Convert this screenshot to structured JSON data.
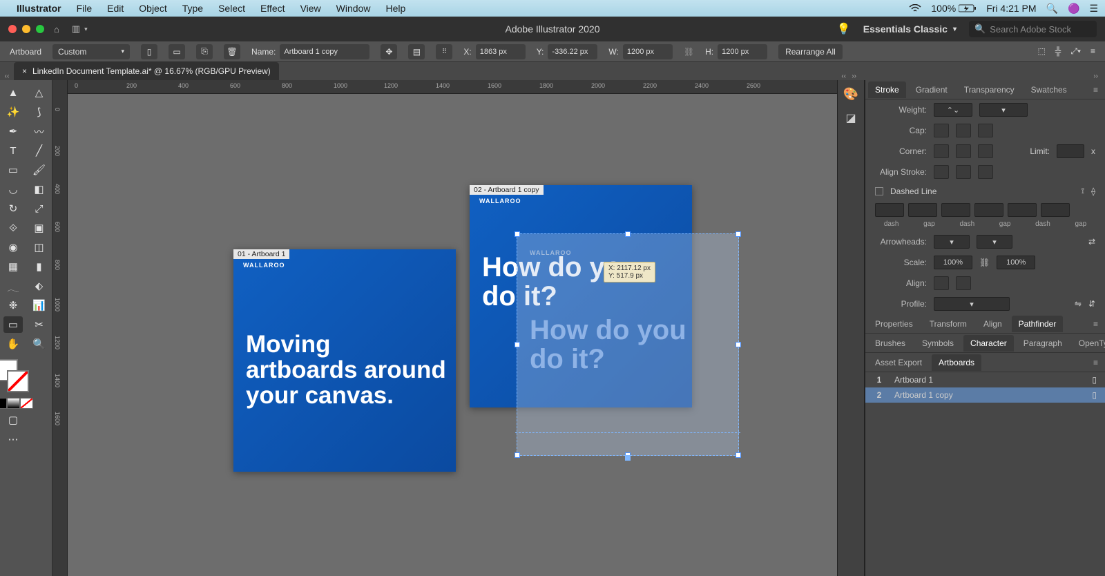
{
  "menubar": {
    "app": "Illustrator",
    "items": [
      "File",
      "Edit",
      "Object",
      "Type",
      "Select",
      "Effect",
      "View",
      "Window",
      "Help"
    ],
    "battery": "100%",
    "time": "Fri 4:21 PM"
  },
  "titlebar": {
    "title": "Adobe Illustrator 2020",
    "workspace": "Essentials Classic",
    "search_placeholder": "Search Adobe Stock"
  },
  "controlbar": {
    "tool": "Artboard",
    "preset": "Custom",
    "name_label": "Name:",
    "name_value": "Artboard 1 copy",
    "X_label": "X:",
    "X": "1863 px",
    "Y_label": "Y:",
    "Y": "-336.22 px",
    "W_label": "W:",
    "W": "1200 px",
    "H_label": "H:",
    "H": "1200 px",
    "rearrange": "Rearrange All"
  },
  "doc_tab": {
    "name": "LinkedIn Document Template.ai* @ 16.67% (RGB/GPU Preview)"
  },
  "ruler_ticks": [
    "0",
    "200",
    "400",
    "600",
    "800",
    "1000",
    "1200",
    "1400",
    "1600",
    "1800",
    "2000",
    "2200",
    "2400",
    "2600"
  ],
  "vruler_ticks": [
    "0",
    "200",
    "400",
    "600",
    "800",
    "1000",
    "1200",
    "1400",
    "1600"
  ],
  "artboards": {
    "a1": {
      "label": "01 - Artboard 1",
      "brand": "WALLAROO",
      "text": "Moving artboards around your canvas."
    },
    "a2": {
      "label": "02 - Artboard 1 copy",
      "brand": "WALLAROO",
      "text": "How do you do it?"
    }
  },
  "ghost": {
    "brand": "WALLAROO",
    "text": "How do you do it?",
    "tooltip_x": "X: 2117.12 px",
    "tooltip_y": "Y: 517.9 px"
  },
  "panels": {
    "row1": [
      "Stroke",
      "Gradient",
      "Transparency",
      "Swatches"
    ],
    "stroke": {
      "weight": "Weight:",
      "cap": "Cap:",
      "corner": "Corner:",
      "limit": "Limit:",
      "align": "Align Stroke:",
      "dashed": "Dashed Line",
      "dash": "dash",
      "gap": "gap",
      "arrowheads": "Arrowheads:",
      "scale": "Scale:",
      "alignarrow": "Align:",
      "profile": "Profile:",
      "scaleval": "100%"
    },
    "row2": [
      "Properties",
      "Transform",
      "Align",
      "Pathfinder"
    ],
    "row3": [
      "Brushes",
      "Symbols",
      "Character",
      "Paragraph",
      "OpenType"
    ],
    "row4": [
      "Asset Export",
      "Artboards"
    ],
    "artboards": [
      {
        "num": "1",
        "name": "Artboard 1"
      },
      {
        "num": "2",
        "name": "Artboard 1 copy"
      }
    ]
  }
}
